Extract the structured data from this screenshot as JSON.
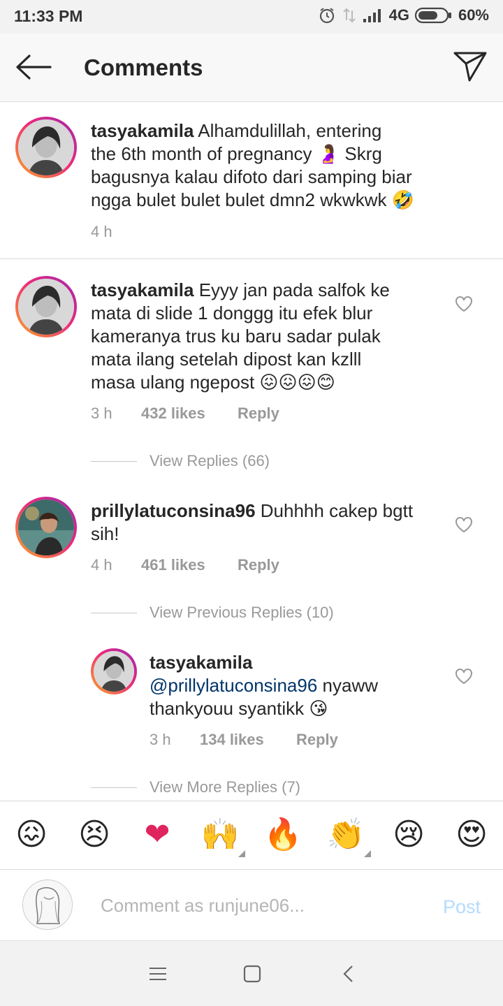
{
  "status_bar": {
    "time": "11:33 PM",
    "network": "4G",
    "battery": "60%"
  },
  "header": {
    "title": "Comments"
  },
  "caption": {
    "username": "tasyakamila",
    "text": "Alhamdulillah, entering the 6th month of pregnancy 🤰 Skrg bagusnya kalau difoto dari samping biar ngga bulet bulet bulet dmn2 wkwkwk 🤣",
    "line1": "Alhamdulillah, entering",
    "line2": "the 6th month of pregnancy 🤰 Skrg",
    "line3": "bagusnya kalau difoto dari samping biar",
    "line4": "ngga bulet bulet bulet dmn2 wkwkwk 🤣",
    "time": "4 h"
  },
  "comments": [
    {
      "username": "tasyakamila",
      "line1": "Eyyy jan pada salfok ke",
      "line2": "mata di slide 1 donggg itu efek blur",
      "line3": "kameranya trus ku baru sadar pulak",
      "line4": "mata ilang setelah dipost kan kzlll",
      "line5": "masa ulang ngepost 😖😖😖😊",
      "time": "3 h",
      "likes": "432 likes",
      "reply": "Reply",
      "view_replies": "View Replies (66)"
    },
    {
      "username": "prillylatuconsina96",
      "line1": "Duhhhh cakep bgtt",
      "line2": "sih!",
      "time": "4 h",
      "likes": "461 likes",
      "reply": "Reply",
      "view_previous": "View Previous Replies (10)",
      "replies": [
        {
          "username": "tasyakamila",
          "mention": "@prillylatuconsina96",
          "line1_rest": " nyaww",
          "line2": "thankyouu syantikk 😘",
          "time": "3 h",
          "likes": "134 likes",
          "reply": "Reply"
        }
      ],
      "view_more": "View More Replies (7)"
    }
  ],
  "emoji_bar": [
    "😖",
    "😣",
    "❤",
    "🙌",
    "🔥",
    "👏",
    "😢",
    "😍"
  ],
  "composer": {
    "placeholder": "Comment as runjune06...",
    "post_label": "Post"
  },
  "colors": {
    "accent": "#003569",
    "muted": "#999999",
    "post_disabled": "#b3dbff"
  }
}
